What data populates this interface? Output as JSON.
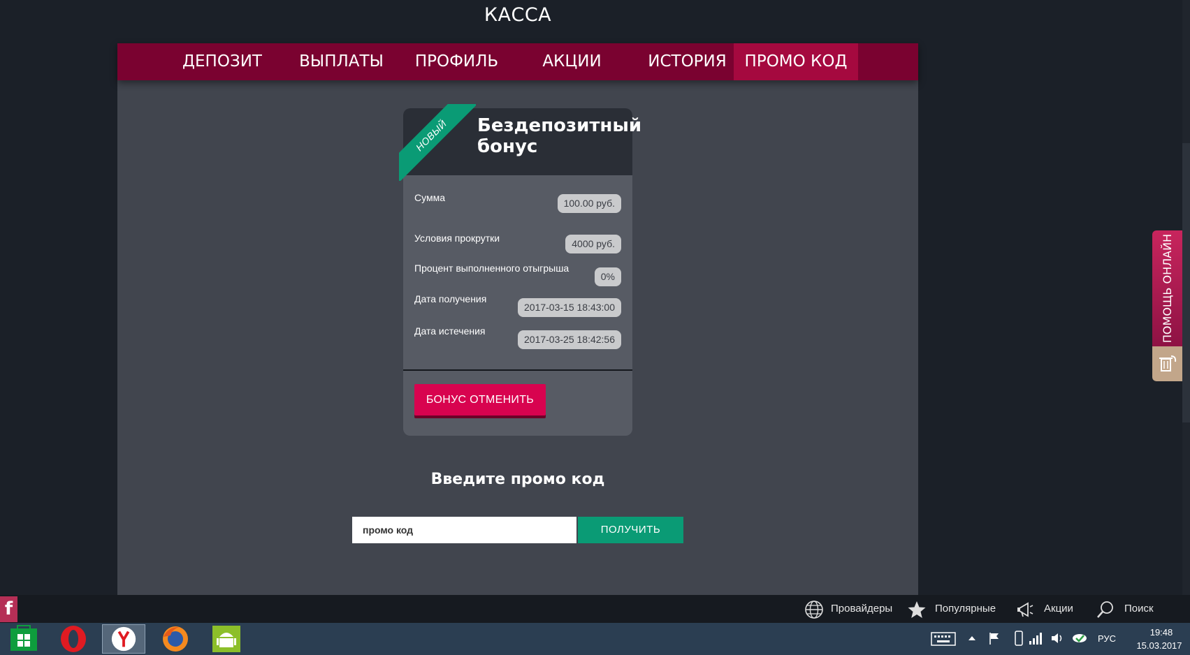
{
  "header": {
    "title": "КАССА"
  },
  "nav": {
    "items": [
      {
        "label": "ДЕПОЗИТ"
      },
      {
        "label": "ВЫПЛАТЫ"
      },
      {
        "label": "ПРОФИЛЬ"
      },
      {
        "label": "АКЦИИ"
      },
      {
        "label": "ИСТОРИЯ"
      },
      {
        "label": "ПРОМО КОД",
        "active": true
      }
    ]
  },
  "bonus_card": {
    "ribbon": "НОВЫЙ",
    "title": "Бездепозитный бонус",
    "rows": [
      {
        "label": "Сумма",
        "value": "100.00 руб."
      },
      {
        "label": "Условия прокрутки",
        "value": "4000 руб."
      },
      {
        "label": "Процент выполненного отыгрыша",
        "value": "0%"
      },
      {
        "label": "Дата получения",
        "value": "2017-03-15 18:43:00"
      },
      {
        "label": "Дата истечения",
        "value": "2017-03-25 18:42:56"
      }
    ],
    "cancel_label": "БОНУС ОТМЕНИТЬ"
  },
  "promo": {
    "title": "Введите промо код",
    "placeholder": "промо код",
    "button_label": "ПОЛУЧИТЬ"
  },
  "side_help": {
    "label": "ПОМОЩЬ ОНЛАЙН"
  },
  "bottom_bar": {
    "facebook": "f",
    "links": [
      {
        "label": "Провайдеры",
        "icon": "globe-icon"
      },
      {
        "label": "Популярные",
        "icon": "star-icon"
      },
      {
        "label": "Акции",
        "icon": "megaphone-icon"
      },
      {
        "label": "Поиск",
        "icon": "search-icon"
      }
    ]
  },
  "taskbar": {
    "apps": [
      "store-icon",
      "opera-icon",
      "yandex-icon",
      "firefox-icon",
      "android-icon"
    ],
    "language": "РУС",
    "time": "19:48",
    "date": "15.03.2017"
  },
  "colors": {
    "nav_bg": "#7a0230",
    "nav_active": "#a5093f",
    "accent_green": "#0a9b75",
    "accent_pink": "#d8034f",
    "panel_bg": "#41454e",
    "page_bg": "#1b2028"
  }
}
